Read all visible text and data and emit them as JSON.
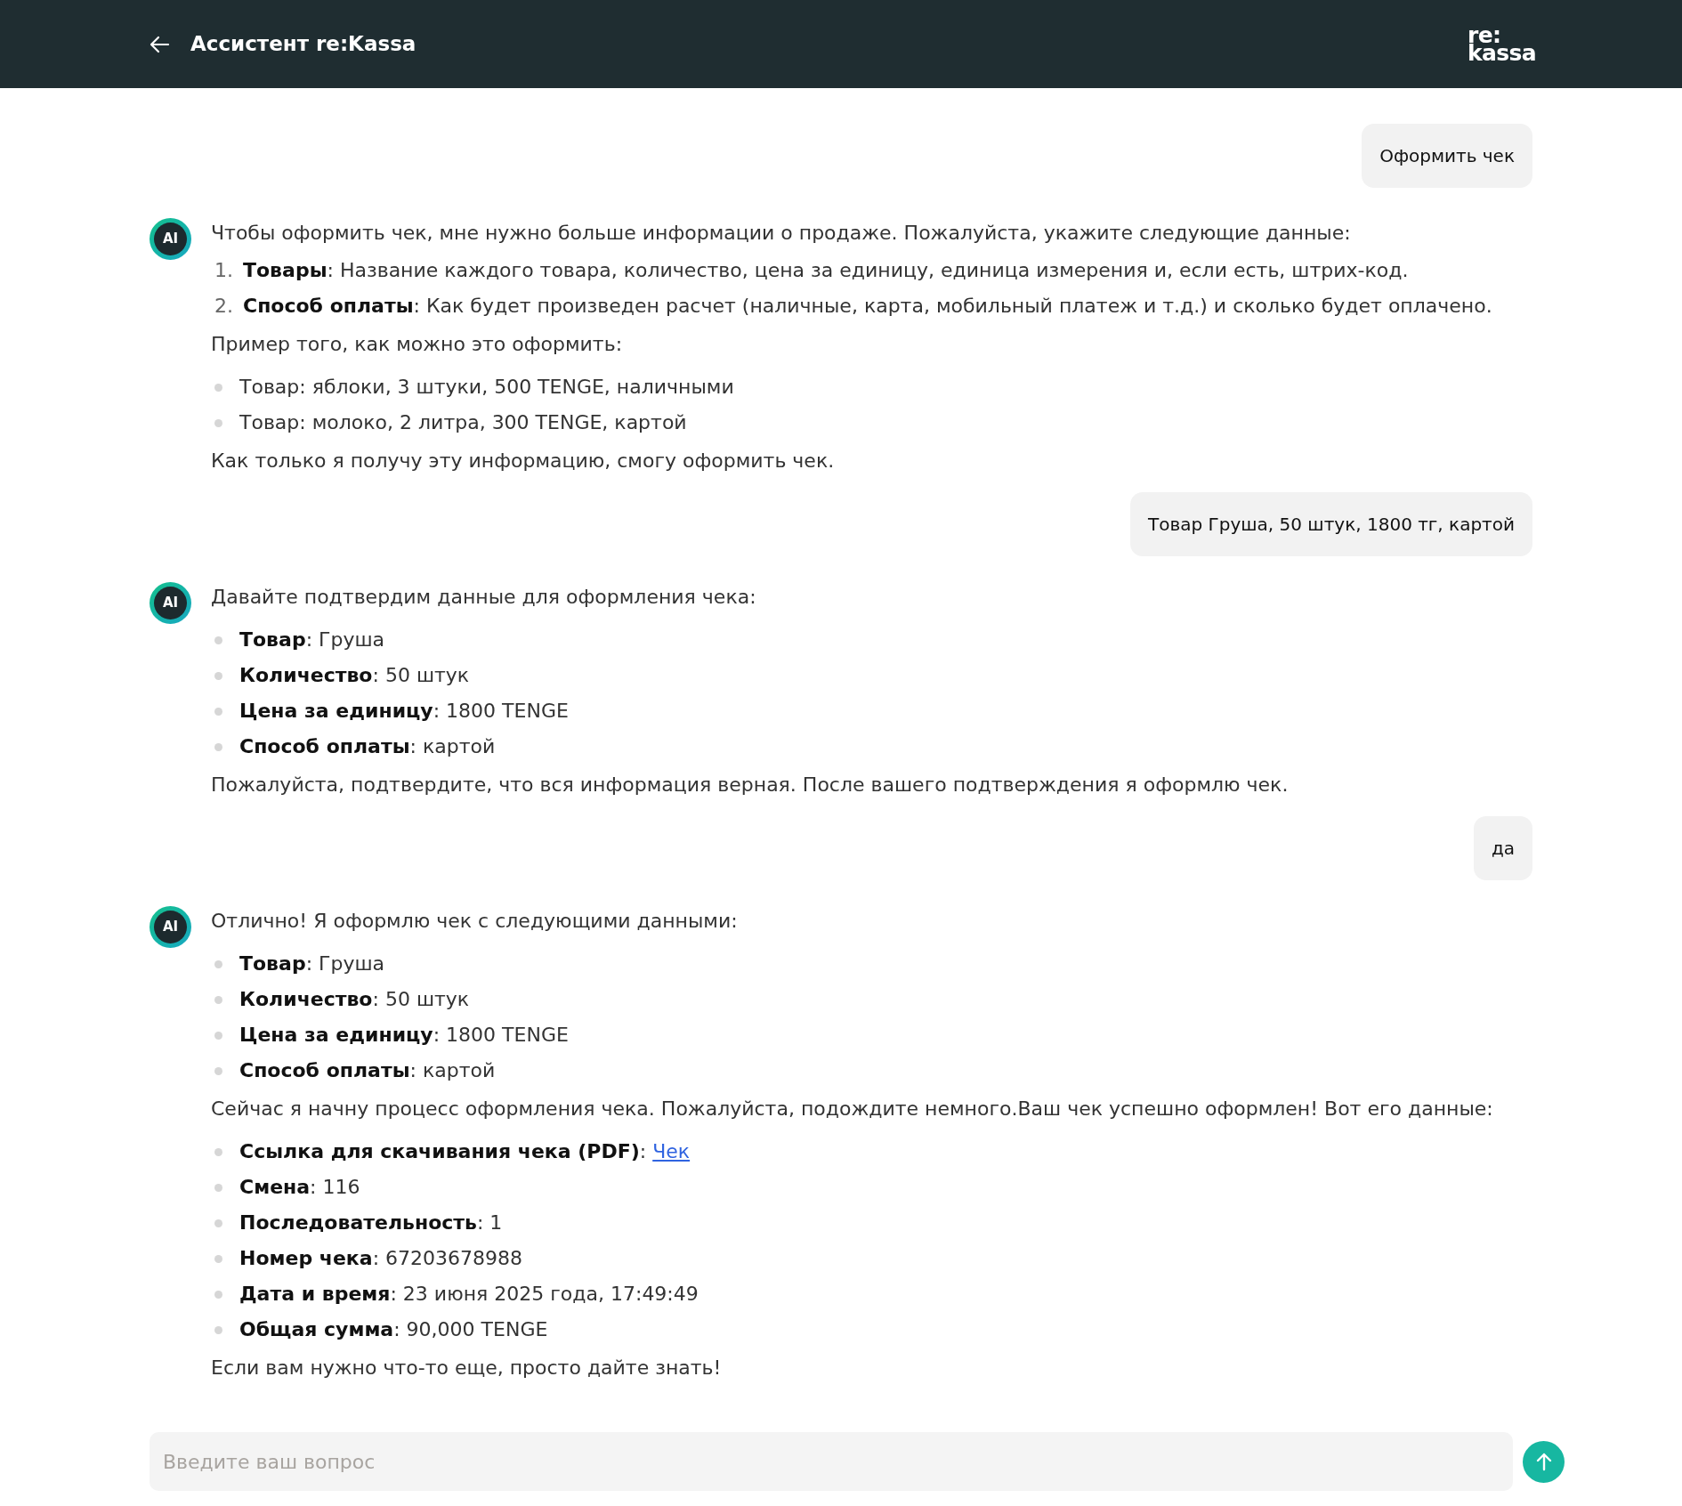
{
  "header": {
    "title": "Ассистент re:Kassa",
    "logo": [
      "re:",
      "kassa"
    ]
  },
  "messages": [
    {
      "kind": "user",
      "text": "Оформить чек"
    },
    {
      "kind": "assistant",
      "avatar": "AI",
      "blocks": [
        {
          "kind": "paragraph",
          "text": "Чтобы оформить чек, мне нужно больше информации о продаже. Пожалуйста, укажите следующие данные:"
        },
        {
          "kind": "ordered",
          "items": [
            {
              "number": "1.",
              "text": "**Товары**: Название каждого товара, количество, цена за единицу, единица измерения и, если есть, штрих-код."
            },
            {
              "number": "2.",
              "text": "**Способ оплаты**: Как будет произведен расчет (наличные, карта, мобильный платеж и т.д.) и сколько будет оплачено."
            }
          ]
        },
        {
          "kind": "paragraph",
          "text": "Пример того, как можно это оформить:"
        },
        {
          "kind": "bullets",
          "items": [
            {
              "text": "Товар: яблоки, 3 штуки, 500 TENGE, наличными"
            },
            {
              "text": "Товар: молоко, 2 литра, 300 TENGE, картой"
            }
          ]
        },
        {
          "kind": "paragraph",
          "text": "Как только я получу эту информацию, смогу оформить чек."
        }
      ]
    },
    {
      "kind": "user",
      "text": "Товар Груша, 50 штук, 1800 тг, картой"
    },
    {
      "kind": "assistant",
      "avatar": "AI",
      "blocks": [
        {
          "kind": "paragraph",
          "text": "Давайте подтвердим данные для оформления чека:"
        },
        {
          "kind": "bullets",
          "items": [
            {
              "text": "**Товар**: Груша"
            },
            {
              "text": "**Количество**: 50 штук"
            },
            {
              "text": "**Цена за единицу**: 1800 TENGE"
            },
            {
              "text": "**Способ оплаты**: картой"
            }
          ]
        },
        {
          "kind": "paragraph",
          "text": "Пожалуйста, подтвердите, что вся информация верная. После вашего подтверждения я оформлю чек."
        }
      ]
    },
    {
      "kind": "user",
      "text": "да"
    },
    {
      "kind": "assistant",
      "avatar": "AI",
      "blocks": [
        {
          "kind": "paragraph",
          "text": "Отлично! Я оформлю чек с следующими данными:"
        },
        {
          "kind": "bullets",
          "items": [
            {
              "text": "**Товар**: Груша"
            },
            {
              "text": "**Количество**: 50 штук"
            },
            {
              "text": "**Цена за единицу**: 1800 TENGE"
            },
            {
              "text": "**Способ оплаты**: картой"
            }
          ]
        },
        {
          "kind": "paragraph",
          "text": "Сейчас я начну процесс оформления чека. Пожалуйста, подождите немного.Ваш чек успешно оформлен! Вот его данные:"
        },
        {
          "kind": "bullets",
          "items": [
            {
              "text": "**Ссылка для скачивания чека (PDF)**: ",
              "link": "Чек"
            },
            {
              "text": "**Смена**: 116"
            },
            {
              "text": "**Последовательность**: 1"
            },
            {
              "text": "**Номер чека**: 67203678988"
            },
            {
              "text": "**Дата и время**: 23 июня 2025 года, 17:49:49"
            },
            {
              "text": "**Общая сумма**: 90,000 TENGE"
            }
          ]
        },
        {
          "kind": "paragraph",
          "text": "Если вам нужно что-то еще, просто дайте знать!"
        }
      ]
    }
  ],
  "composer": {
    "placeholder": "Введите ваш вопрос"
  }
}
